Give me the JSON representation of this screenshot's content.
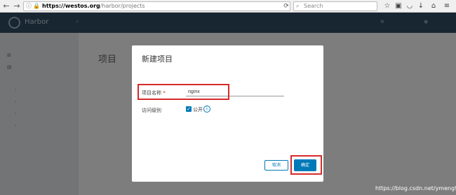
{
  "browser": {
    "url_domain": "https://westos.org",
    "url_path": "/harbor/projects",
    "search_placeholder": "Search"
  },
  "app": {
    "brand": "Harbor",
    "page_title": "项目"
  },
  "modal": {
    "title": "新建项目",
    "name_label": "项目名称",
    "required_mark": "*",
    "name_value": "nginx",
    "access_label": "访问级别",
    "public_label": "公开",
    "cancel_label": "取消",
    "ok_label": "确定"
  },
  "watermark": "https://blog.csdn.net/ymeng9527",
  "colors": {
    "accent": "#0079b8",
    "header": "#2e4d62",
    "highlight": "#d62a2a"
  }
}
